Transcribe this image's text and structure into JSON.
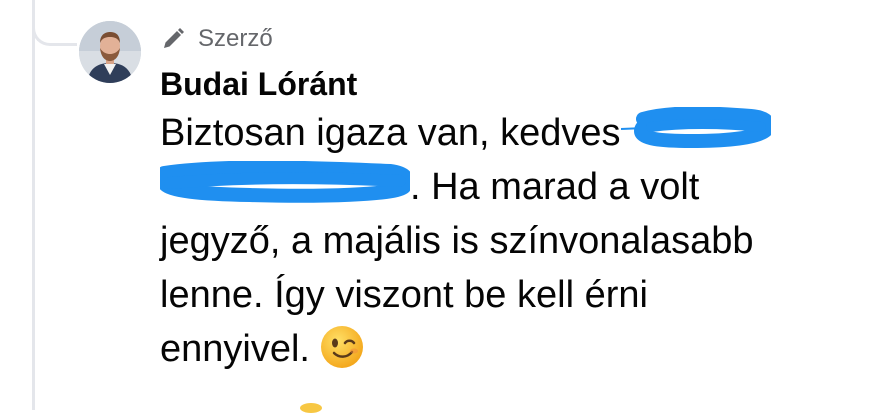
{
  "comment": {
    "badge": "Szerző",
    "author": "Budai Lóránt",
    "text": {
      "part1": "Biztosan igaza van, kedves",
      "part2": ". Ha marad a volt",
      "line3": "jegyző, a majális is színvonalasabb",
      "line4": "lenne. Így viszont be kell érni",
      "line5": "ennyivel."
    }
  },
  "icons": {
    "badge_icon": "pencil-icon",
    "emoji": "winking-face-emoji"
  },
  "colors": {
    "redaction": "#1f8ff0",
    "badge_text": "#65676b",
    "thread_line": "#e4e6eb"
  }
}
